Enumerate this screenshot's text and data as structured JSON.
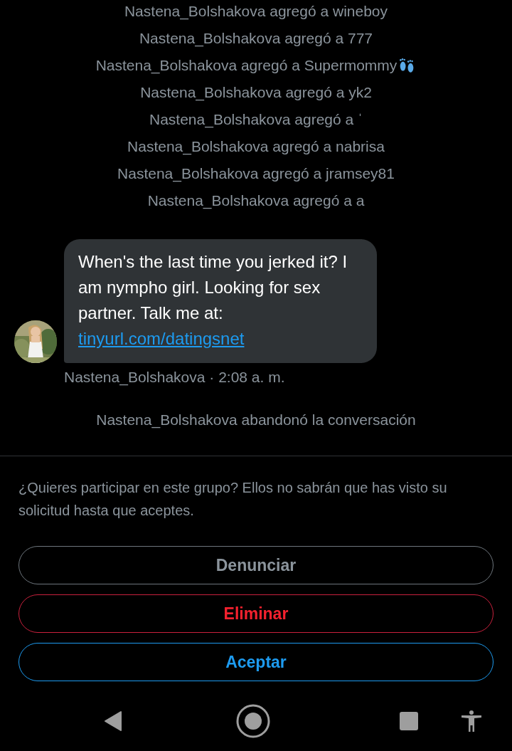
{
  "events": [
    {
      "text": "Nastena_Bolshakova agregó a wineboy",
      "kind": "plain"
    },
    {
      "text": "Nastena_Bolshakova agregó a 777",
      "kind": "plain"
    },
    {
      "text": "Nastena_Bolshakova agregó a Supermommy",
      "kind": "emoji"
    },
    {
      "text": "Nastena_Bolshakova agregó a yk2",
      "kind": "plain"
    },
    {
      "text": "Nastena_Bolshakova agregó a ˈ",
      "kind": "plain"
    },
    {
      "text": "Nastena_Bolshakova agregó a nabrisa",
      "kind": "plain"
    },
    {
      "text": "Nastena_Bolshakova agregó a jramsey81",
      "kind": "plain"
    },
    {
      "text": "Nastena_Bolshakova agregó a a",
      "kind": "plain"
    }
  ],
  "message": {
    "text": "When's the last time you jerked it? I am nympho girl. Looking for sex partner. Talk me at:",
    "link": "tinyurl.com/datingsnet",
    "meta": "Nastena_Bolshakova · 2:08 a. m."
  },
  "left_notice": "Nastena_Bolshakova abandonó la conversación",
  "prompt": "¿Quieres participar en este grupo? Ellos no sabrán que has visto su solicitud hasta que aceptes.",
  "buttons": [
    {
      "label": "Denunciar",
      "kind": "report"
    },
    {
      "label": "Eliminar",
      "kind": "delete"
    },
    {
      "label": "Aceptar",
      "kind": "accept"
    }
  ]
}
